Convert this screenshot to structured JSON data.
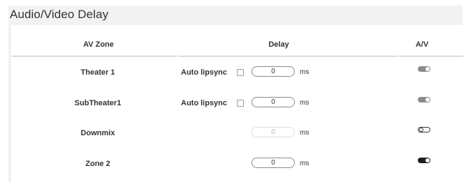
{
  "panel": {
    "title": "Audio/Video Delay"
  },
  "table": {
    "headers": {
      "zone": "AV Zone",
      "delay": "Delay",
      "av": "A/V"
    },
    "auto_lipsync_label": "Auto lipsync",
    "unit": "ms",
    "rows": [
      {
        "zone": "Theater 1",
        "show_auto_lipsync": true,
        "auto_lipsync_checked": false,
        "delay": "0",
        "delay_enabled": true,
        "av_toggle": "on",
        "av_toggle_color": "#8c8c8c"
      },
      {
        "zone": "SubTheater1",
        "show_auto_lipsync": true,
        "auto_lipsync_checked": false,
        "delay": "0",
        "delay_enabled": true,
        "av_toggle": "on",
        "av_toggle_color": "#8c8c8c"
      },
      {
        "zone": "Downmix",
        "show_auto_lipsync": false,
        "delay": "0",
        "delay_enabled": false,
        "av_toggle": "off",
        "av_toggle_color": "#333333"
      },
      {
        "zone": "Zone 2",
        "show_auto_lipsync": false,
        "delay": "0",
        "delay_enabled": true,
        "av_toggle": "on",
        "av_toggle_color": "#1d1d1d"
      }
    ]
  }
}
